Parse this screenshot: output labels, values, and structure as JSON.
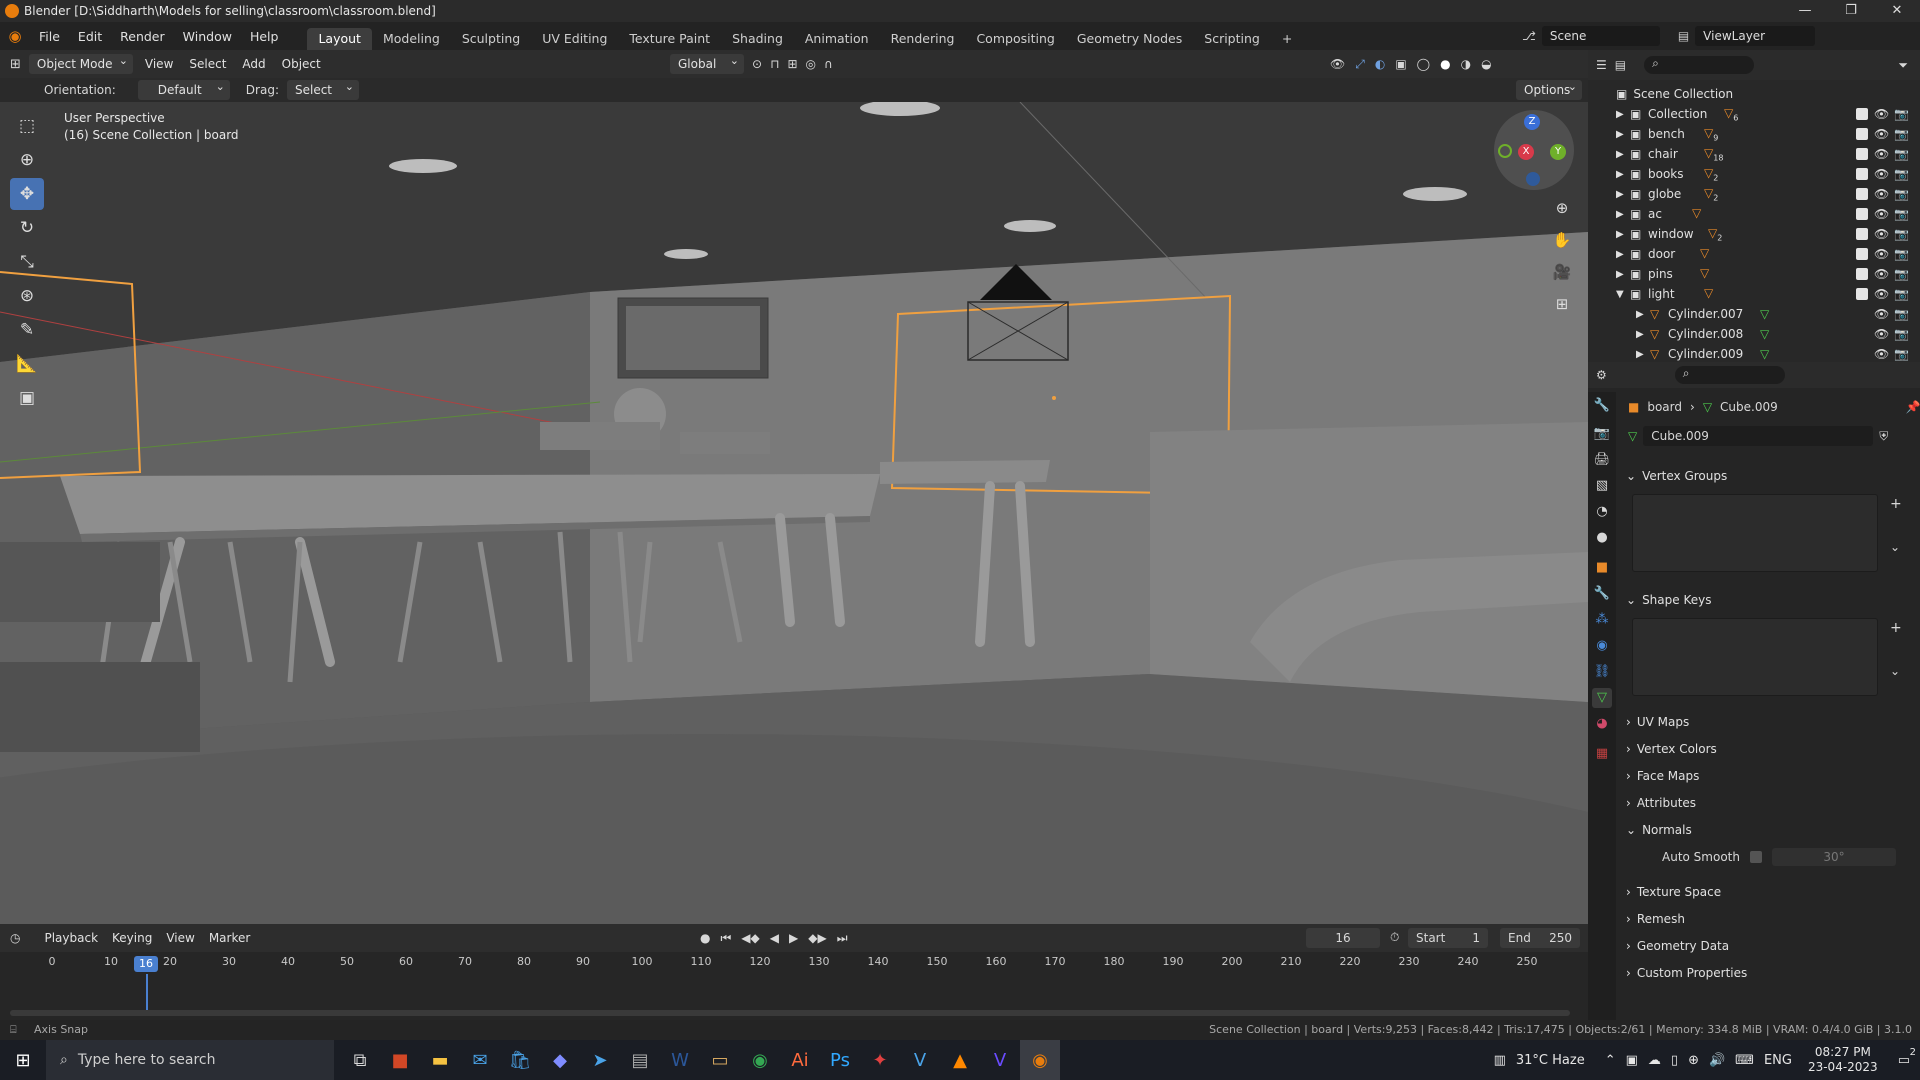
{
  "window": {
    "title": "Blender [D:\\Siddharth\\Models for selling\\classroom\\classroom.blend]"
  },
  "menubar": {
    "menus": [
      "File",
      "Edit",
      "Render",
      "Window",
      "Help"
    ],
    "workspaces": [
      "Layout",
      "Modeling",
      "Sculpting",
      "UV Editing",
      "Texture Paint",
      "Shading",
      "Animation",
      "Rendering",
      "Compositing",
      "Geometry Nodes",
      "Scripting"
    ],
    "add_tab": "+",
    "scene": "Scene",
    "view_layer": "ViewLayer"
  },
  "viewport_header": {
    "mode": "Object Mode",
    "menus": [
      "View",
      "Select",
      "Add",
      "Object"
    ],
    "transform": "Global"
  },
  "tool_header": {
    "orientation_label": "Orientation:",
    "orientation": "Default",
    "drag_label": "Drag:",
    "drag": "Select Box",
    "options": "Options"
  },
  "viewport": {
    "perspective": "User Perspective",
    "collection_info": "(16) Scene Collection | board",
    "gizmo": {
      "x": "X",
      "y": "Y",
      "z": "Z"
    }
  },
  "outliner": {
    "root": "Scene Collection",
    "items": [
      {
        "name": "Collection",
        "count": "6"
      },
      {
        "name": "bench",
        "count": "9"
      },
      {
        "name": "chair",
        "count": "18"
      },
      {
        "name": "books",
        "count": "2"
      },
      {
        "name": "globe",
        "count": "2"
      },
      {
        "name": "ac",
        "count": ""
      },
      {
        "name": "window",
        "count": "2"
      },
      {
        "name": "door",
        "count": ""
      },
      {
        "name": "pins",
        "count": ""
      },
      {
        "name": "light",
        "count": ""
      }
    ],
    "children": [
      "Cylinder.007",
      "Cylinder.008",
      "Cylinder.009"
    ]
  },
  "properties": {
    "breadcrumb_object": "board",
    "breadcrumb_data": "Cube.009",
    "mesh_name": "Cube.009",
    "panels": {
      "vertex_groups": "Vertex Groups",
      "shape_keys": "Shape Keys",
      "uv_maps": "UV Maps",
      "vertex_colors": "Vertex Colors",
      "face_maps": "Face Maps",
      "attributes": "Attributes",
      "normals": "Normals",
      "auto_smooth": "Auto Smooth",
      "auto_smooth_angle": "30°",
      "texture_space": "Texture Space",
      "remesh": "Remesh",
      "geometry_data": "Geometry Data",
      "custom_properties": "Custom Properties"
    }
  },
  "timeline": {
    "menus": [
      "Playback",
      "Keying",
      "View",
      "Marker"
    ],
    "current_frame": "16",
    "start_label": "Start",
    "start": "1",
    "end_label": "End",
    "end": "250",
    "ticks": [
      "0",
      "10",
      "20",
      "30",
      "40",
      "50",
      "60",
      "70",
      "80",
      "90",
      "100",
      "110",
      "120",
      "130",
      "140",
      "150",
      "160",
      "170",
      "180",
      "190",
      "200",
      "210",
      "220",
      "230",
      "240",
      "250"
    ],
    "frame_marker": "16"
  },
  "statusbar": {
    "left": "Axis Snap",
    "right": "Scene Collection | board | Verts:9,253 | Faces:8,442 | Tris:17,475 | Objects:2/61 | Memory: 334.8 MiB | VRAM: 0.4/4.0 GiB | 3.1.0"
  },
  "taskbar": {
    "search_placeholder": "Type here to search",
    "weather": "31°C Haze",
    "language": "ENG",
    "time": "08:27 PM",
    "date": "23-04-2023",
    "notifications": "2"
  }
}
